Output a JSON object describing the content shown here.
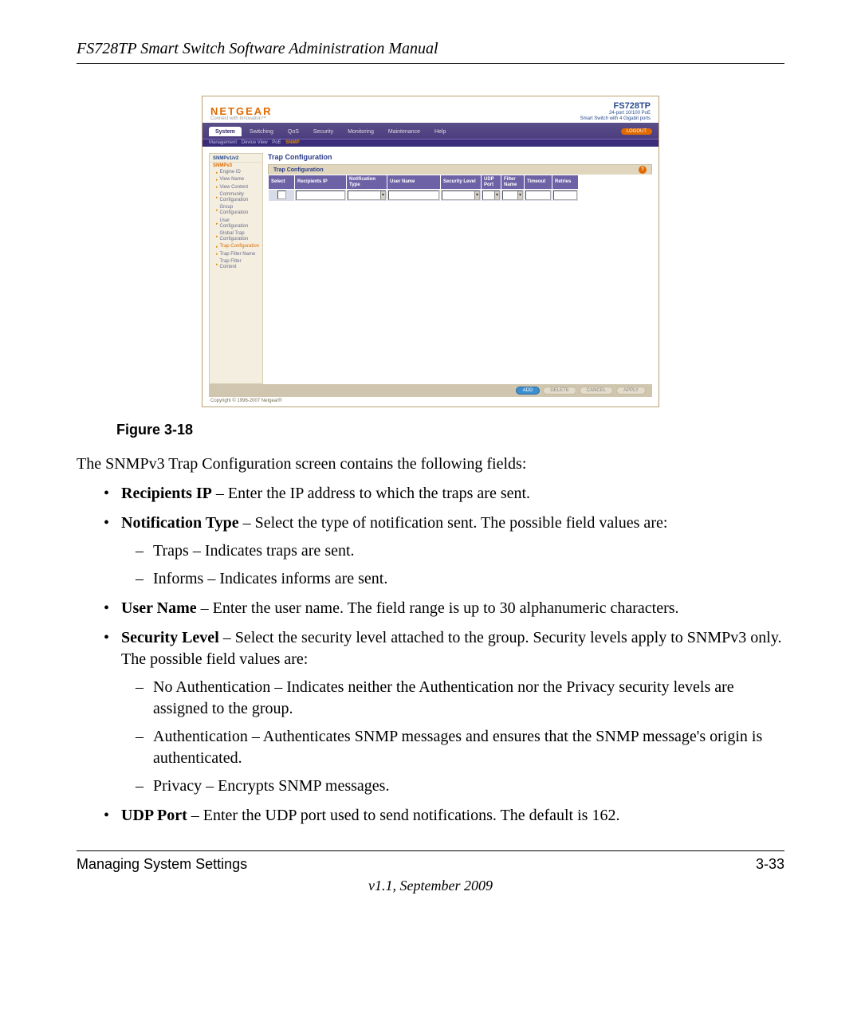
{
  "header": {
    "title": "FS728TP Smart Switch Software Administration Manual"
  },
  "screenshot": {
    "brand": "NETGEAR",
    "tagline": "Connect with Innovation™",
    "device": {
      "model": "FS728TP",
      "desc1": "24-port 10/100 PoE",
      "desc2": "Smart Switch with 4 Gigabit ports"
    },
    "logout": "LOGOUT",
    "tabs": [
      "System",
      "Switching",
      "QoS",
      "Security",
      "Monitoring",
      "Maintenance",
      "Help"
    ],
    "subnav": [
      "Management",
      "Device View",
      "PoE",
      "SNMP"
    ],
    "sidebar_groups": [
      {
        "label": "SNMPv1/v2",
        "items": []
      },
      {
        "label": "SNMPv3",
        "items": [
          "Engine ID",
          "View Name",
          "View Content",
          "Community Configuration",
          "Group Configuration",
          "User Configuration",
          "Global Trap Configuration",
          "Trap Configuration",
          "Trap Filter Name",
          "Trap Filter Content"
        ]
      }
    ],
    "sidebar_selected": "Trap Configuration",
    "panel_title": "Trap Configuration",
    "panel_subtitle": "Trap Configuration",
    "table_headers": [
      "Select",
      "Recipients IP",
      "Notification Type",
      "User Name",
      "Security Level",
      "UDP Port",
      "Filter Name",
      "Timeout",
      "Retries"
    ],
    "footer_buttons": [
      "ADD",
      "DELETE",
      "CANCEL",
      "APPLY"
    ],
    "copyright": "Copyright © 1996-2007 Netgear®"
  },
  "caption": "Figure 3-18",
  "intro": "The SNMPv3 Trap Configuration screen contains the following fields:",
  "bullets": [
    {
      "term": "Recipients IP",
      "text": " – Enter the IP address to which the traps are sent."
    },
    {
      "term": "Notification Type",
      "text": " – Select the type of notification sent. The possible field values are:",
      "sub": [
        "Traps – Indicates traps are sent.",
        "Informs – Indicates informs are sent."
      ]
    },
    {
      "term": "User Name",
      "text": " – Enter the user name. The field range is up to 30 alphanumeric characters."
    },
    {
      "term": "Security Level",
      "text": " – Select the security level attached to the group. Security levels apply to SNMPv3 only. The possible field values are:",
      "sub": [
        "No Authentication – Indicates neither the Authentication nor the Privacy security levels are assigned to the group.",
        "Authentication – Authenticates SNMP messages and ensures that the SNMP message's origin is authenticated.",
        "Privacy – Encrypts SNMP messages."
      ]
    },
    {
      "term": "UDP Port",
      "text": " – Enter the UDP port used to send notifications. The default is 162."
    }
  ],
  "footer": {
    "section": "Managing System Settings",
    "pagenum": "3-33",
    "version": "v1.1, September 2009"
  }
}
